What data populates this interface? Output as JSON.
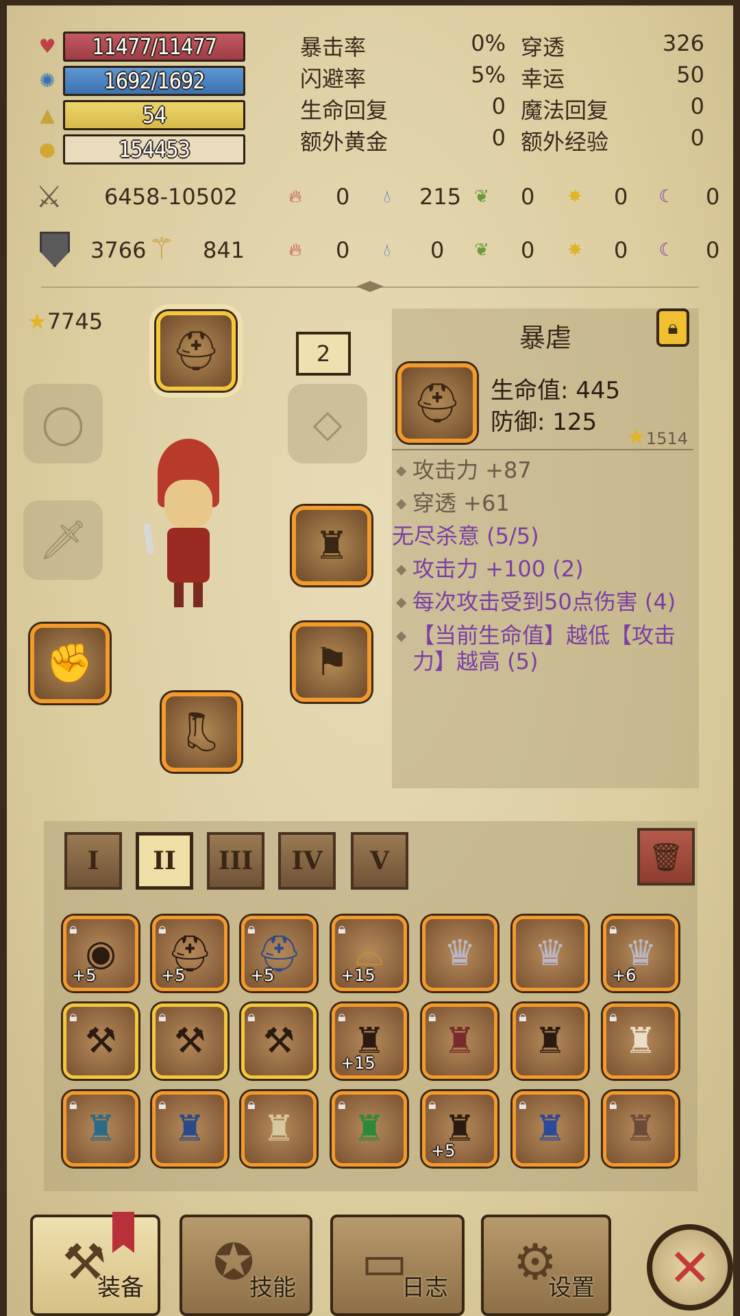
{
  "stats": {
    "hp": "11477/11477",
    "mp": "1692/1692",
    "level": "54",
    "gold": "154453",
    "grid": [
      {
        "name1": "暴击率",
        "val1": "0%",
        "name2": "穿透",
        "val2": "326"
      },
      {
        "name1": "闪避率",
        "val1": "5%",
        "name2": "幸运",
        "val2": "50"
      },
      {
        "name1": "生命回复",
        "val1": "0",
        "name2": "魔法回复",
        "val2": "0"
      },
      {
        "name1": "额外黄金",
        "val1": "0",
        "name2": "额外经验",
        "val2": "0"
      }
    ],
    "attack": "6458-10502",
    "defense": "3766",
    "magic_power": "841",
    "attack_elements": [
      "0",
      "215",
      "0",
      "0",
      "0"
    ],
    "defense_elements": [
      "0",
      "0",
      "0",
      "0",
      "0"
    ]
  },
  "equipment": {
    "star_total": "7745",
    "badge": "2"
  },
  "item_info": {
    "title": "暴虐",
    "hp_stat": "生命值: 445",
    "def_stat": "防御: 125",
    "score": "1514",
    "mods": [
      "攻击力 +87",
      "穿透 +61"
    ],
    "set_name": "无尽杀意 (5/5)",
    "set_mods": [
      "攻击力 +100 (2)",
      "每次攻击受到50点伤害 (4)",
      "【当前生命值】越低【攻击力】越高 (5)"
    ]
  },
  "tabs": [
    "I",
    "II",
    "III",
    "IV",
    "V"
  ],
  "inventory": {
    "row1_plus": [
      "+5",
      "+5",
      "+5",
      "+15",
      "",
      "",
      "+6"
    ],
    "row2_plus": [
      "",
      "",
      "",
      "+15",
      "",
      "",
      ""
    ],
    "row3_plus": [
      "",
      "",
      "",
      "",
      "+5",
      "",
      ""
    ]
  },
  "nav": {
    "equip": "装备",
    "skills": "技能",
    "log": "日志",
    "settings": "设置"
  }
}
